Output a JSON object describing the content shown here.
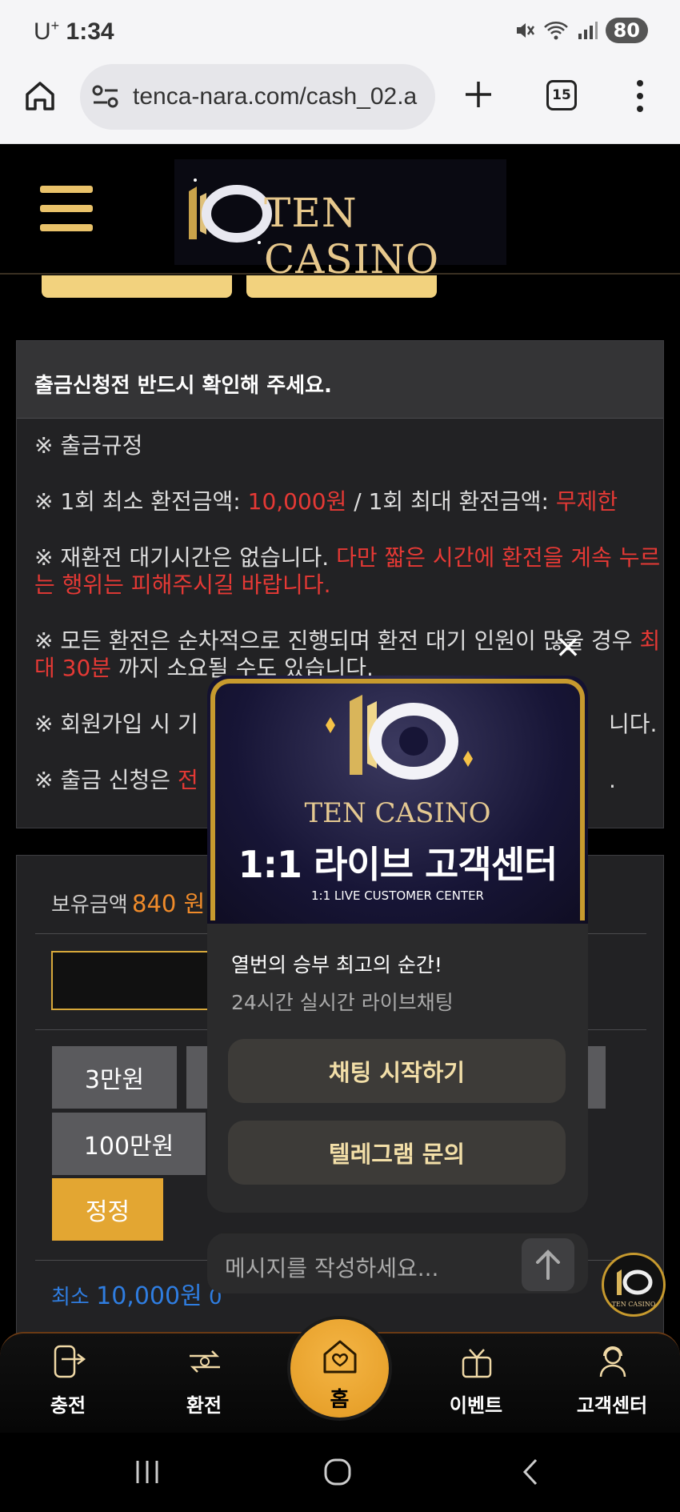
{
  "status_bar": {
    "carrier": "U",
    "carrier_sup": "+",
    "time": "1:34",
    "battery": "80"
  },
  "browser": {
    "url": "tenca-nara.com/cash_02.a",
    "tab_count": "15"
  },
  "header": {
    "logo_text": "TEN CASINO"
  },
  "notice": {
    "title": "출금신청전 반드시 확인해 주세요.",
    "rule_heading": "※ 출금규정",
    "line2_prefix": "※ 1회 최소 환전금액: ",
    "line2_min": "10,000원",
    "line2_mid": " / 1회 최대 환전금액: ",
    "line2_max": "무제한",
    "line3_prefix": "※ 재환전 대기시간은 없습니다. ",
    "line3_red": "다만 짧은 시간에 환전을 계속 누르는 행위는 피해주시길 바랍니다.",
    "line4_prefix": "※ 모든 환전은 순차적으로 진행되며 환전 대기 인원이 많을 경우 ",
    "line4_red": "최대 30분",
    "line4_suffix": " 까지 소요될 수도 있습니다.",
    "line5_prefix": "※ 회원가입 시 기",
    "line5_suffix": "니다.",
    "line6_prefix": "※ 출금 신청은 ",
    "line6_red": "전",
    "line6_suffix": "."
  },
  "panel": {
    "balance_label": "보유금액",
    "balance_amount": "840 원",
    "chips": [
      "3만원",
      "100만원"
    ],
    "reset_label": "정정",
    "min_prefix": "최소",
    "min_amount": "10,000원",
    "min_suffix": "0"
  },
  "popup": {
    "brand": "TEN CASINO",
    "banner_title": "1:1 라이브 고객센터",
    "banner_sub": "1:1 LIVE CUSTOMER CENTER",
    "headline": "열번의 승부 최고의 순간!",
    "subline": "24시간 실시간 라이브채팅",
    "chat_button": "채팅 시작하기",
    "telegram_button": "텔레그램 문의",
    "message_placeholder": "메시지를 작성하세요...",
    "close_symbol": "×"
  },
  "float_logo_text": "TEN CASINO",
  "bottom_nav": {
    "charge": "충전",
    "exchange": "환전",
    "home": "홈",
    "event": "이벤트",
    "support": "고객센터"
  },
  "colors": {
    "gold": "#e3a632",
    "red": "#e53935",
    "orange": "#f08b2a",
    "blue": "#2f7de0"
  }
}
